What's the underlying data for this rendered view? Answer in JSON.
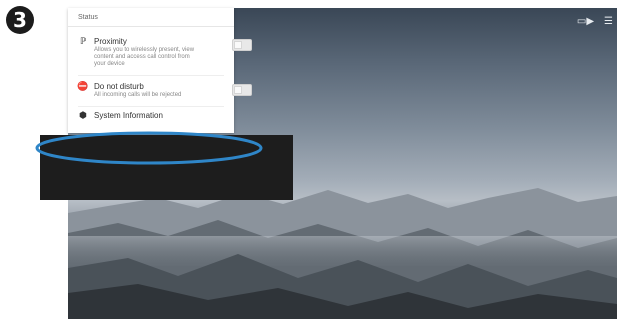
{
  "step": {
    "number": "3",
    "glyph": "❸"
  },
  "panel": {
    "header": "Status",
    "items": [
      {
        "icon": "proximity-icon",
        "glyph": "ℙ",
        "title": "Proximity",
        "description": "Allows you to wirelessly present, view content and access call control from your device",
        "toggle_state": "off"
      },
      {
        "icon": "do-not-disturb-icon",
        "glyph": "⛔",
        "title": "Do not disturb",
        "description": "All incoming calls will be rejected",
        "toggle_state": "off"
      },
      {
        "icon": "system-info-icon",
        "glyph": "⬢",
        "title": "System Information"
      }
    ]
  },
  "topbar": {
    "icons": [
      {
        "name": "screen-share-icon",
        "glyph": "▭▶"
      },
      {
        "name": "menu-icon",
        "glyph": "☰"
      }
    ]
  },
  "colors": {
    "highlight": "#2f86c8",
    "overlay": "#1d1d1d",
    "panel_bg": "#ffffff"
  }
}
